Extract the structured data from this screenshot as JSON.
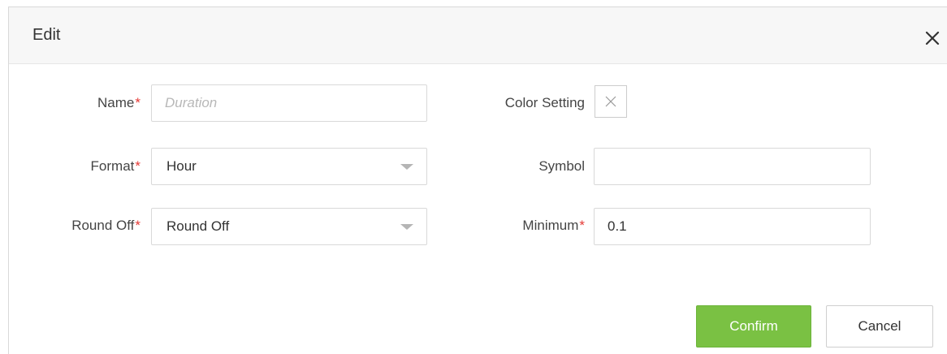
{
  "dialog": {
    "title": "Edit",
    "close_icon": "close-icon"
  },
  "form": {
    "name": {
      "label": "Name",
      "required": "*",
      "placeholder": "Duration",
      "value": ""
    },
    "color_setting": {
      "label": "Color Setting",
      "swatch_icon": "no-color-x-icon"
    },
    "format": {
      "label": "Format",
      "required": "*",
      "value": "Hour",
      "icon": "chevron-down-icon"
    },
    "symbol": {
      "label": "Symbol",
      "value": ""
    },
    "round_off": {
      "label": "Round Off",
      "required": "*",
      "value": "Round Off",
      "icon": "chevron-down-icon"
    },
    "minimum": {
      "label": "Minimum",
      "required": "*",
      "value": "0.1"
    }
  },
  "buttons": {
    "confirm": "Confirm",
    "cancel": "Cancel"
  },
  "colors": {
    "confirm_bg": "#7ac143",
    "required_asterisk": "#e53935",
    "header_bg": "#f7f7f7"
  }
}
